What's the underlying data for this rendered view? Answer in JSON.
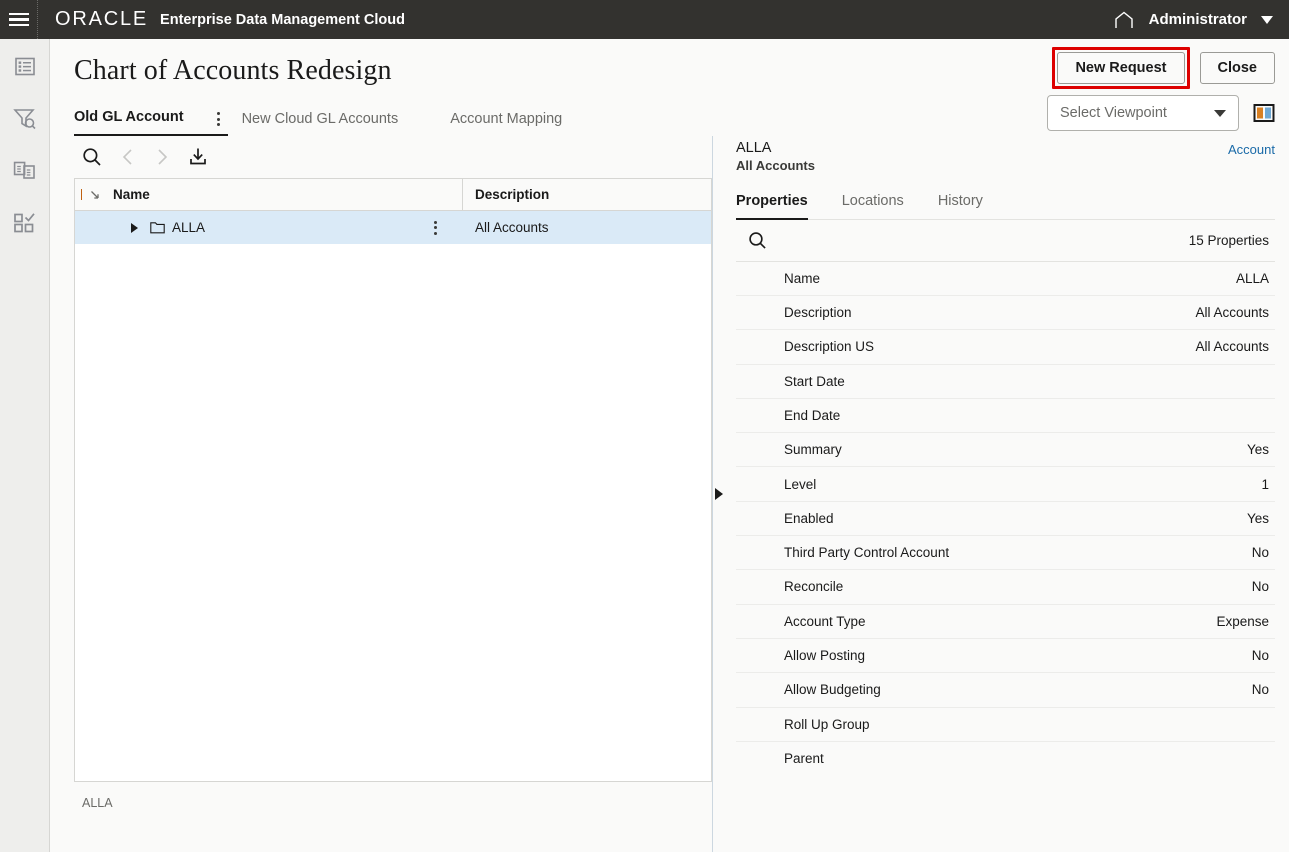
{
  "header": {
    "menu_icon": "hamburger-icon",
    "brand": "ORACLE",
    "app_title": "Enterprise Data Management Cloud",
    "home_icon": "home-icon",
    "user": "Administrator",
    "user_caret_icon": "chevron-down-icon"
  },
  "rail": {
    "items": [
      {
        "name": "sidebar-item-browse",
        "icon": "list-view-icon"
      },
      {
        "name": "sidebar-item-requests",
        "icon": "filter-search-icon"
      },
      {
        "name": "sidebar-item-compare",
        "icon": "compare-documents-icon"
      },
      {
        "name": "sidebar-item-validate",
        "icon": "checklist-grid-icon"
      }
    ]
  },
  "page": {
    "title": "Chart of Accounts Redesign",
    "new_request_label": "New Request",
    "close_label": "Close",
    "highlight_color": "#dd0000"
  },
  "tabs": [
    {
      "label": "Old GL Account",
      "active": true
    },
    {
      "label": "New Cloud GL Accounts",
      "active": false
    },
    {
      "label": "Account Mapping",
      "active": false
    }
  ],
  "viewpoint": {
    "placeholder": "Select Viewpoint",
    "value": "",
    "caret_icon": "chevron-down-icon",
    "split_view_icon": "split-panel-icon"
  },
  "grid_toolbar": {
    "search_icon": "search-icon",
    "prev_icon": "chevron-left-icon",
    "next_icon": "chevron-right-icon",
    "export_icon": "download-export-icon"
  },
  "grid": {
    "columns": [
      "Name",
      "Description"
    ],
    "header_arrow_icon": "collapse-arrow-icon",
    "rows": [
      {
        "name": "ALLA",
        "description": "All Accounts",
        "selected": true,
        "expander_icon": "expand-triangle-icon",
        "node_icon": "folder-icon",
        "kebab_icon": "kebab-menu-icon"
      }
    ]
  },
  "status_bar": {
    "text": "ALLA"
  },
  "splitter": {
    "handle_icon": "splitter-arrow-icon"
  },
  "inspector": {
    "title": "ALLA",
    "subtitle": "All Accounts",
    "link": "Account",
    "tabs": [
      {
        "label": "Properties",
        "active": true
      },
      {
        "label": "Locations",
        "active": false
      },
      {
        "label": "History",
        "active": false
      }
    ],
    "search_icon": "search-icon",
    "count_label": "15 Properties",
    "properties": [
      {
        "label": "Name",
        "value": "ALLA"
      },
      {
        "label": "Description",
        "value": "All Accounts"
      },
      {
        "label": "Description US",
        "value": "All Accounts"
      },
      {
        "label": "Start Date",
        "value": ""
      },
      {
        "label": "End Date",
        "value": ""
      },
      {
        "label": "Summary",
        "value": "Yes"
      },
      {
        "label": "Level",
        "value": "1"
      },
      {
        "label": "Enabled",
        "value": "Yes"
      },
      {
        "label": "Third Party Control Account",
        "value": "No"
      },
      {
        "label": "Reconcile",
        "value": "No"
      },
      {
        "label": "Account Type",
        "value": "Expense"
      },
      {
        "label": "Allow Posting",
        "value": "No"
      },
      {
        "label": "Allow Budgeting",
        "value": "No"
      },
      {
        "label": "Roll Up Group",
        "value": ""
      },
      {
        "label": "Parent",
        "value": ""
      }
    ]
  }
}
